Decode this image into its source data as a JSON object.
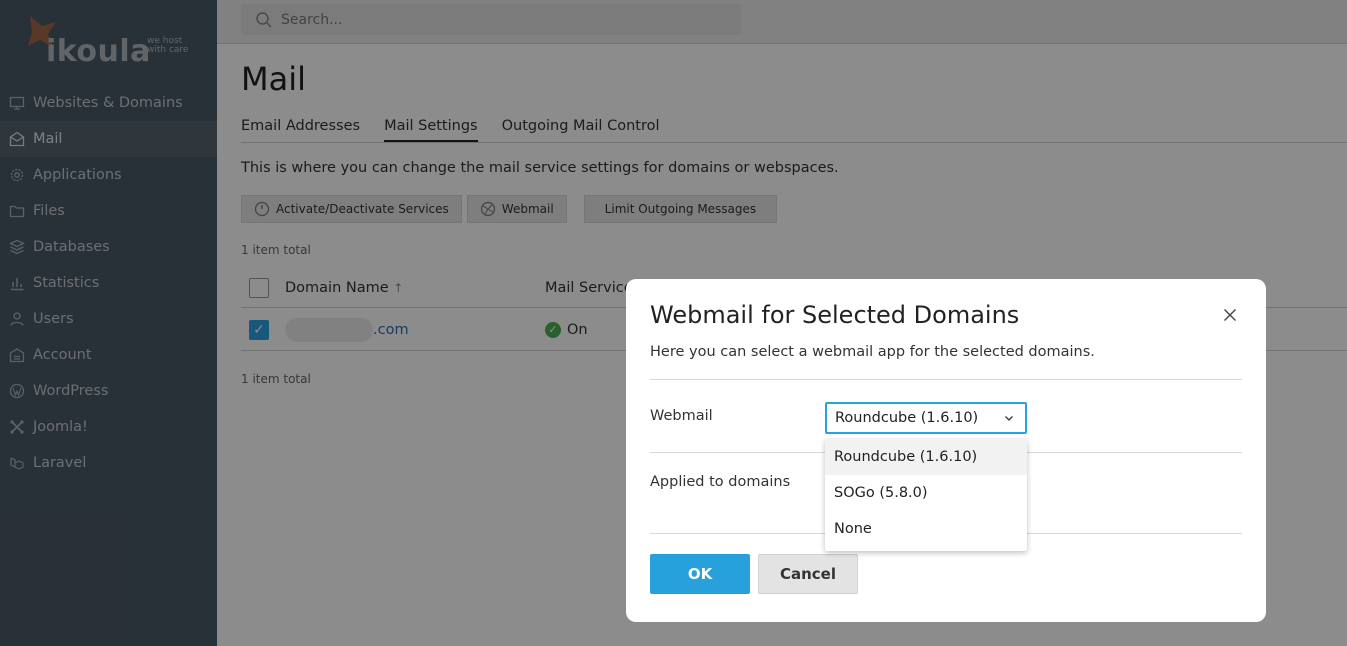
{
  "brand": {
    "logo_text": "ikoula",
    "tagline_1": "we host",
    "tagline_2": "with care"
  },
  "sidebar": {
    "items": [
      {
        "label": "Websites & Domains",
        "icon": "monitor-icon"
      },
      {
        "label": "Mail",
        "icon": "mail-icon",
        "active": true
      },
      {
        "label": "Applications",
        "icon": "gear-icon"
      },
      {
        "label": "Files",
        "icon": "folder-icon"
      },
      {
        "label": "Databases",
        "icon": "database-icon"
      },
      {
        "label": "Statistics",
        "icon": "bar-chart-icon"
      },
      {
        "label": "Users",
        "icon": "user-icon"
      },
      {
        "label": "Account",
        "icon": "account-icon"
      },
      {
        "label": "WordPress",
        "icon": "wordpress-icon"
      },
      {
        "label": "Joomla!",
        "icon": "joomla-icon"
      },
      {
        "label": "Laravel",
        "icon": "laravel-icon"
      }
    ],
    "collapse_glyph": "‹"
  },
  "search": {
    "placeholder": "Search..."
  },
  "page": {
    "title": "Mail",
    "tabs": [
      {
        "label": "Email Addresses"
      },
      {
        "label": "Mail Settings",
        "active": true
      },
      {
        "label": "Outgoing Mail Control"
      }
    ],
    "description": "This is where you can change the mail service settings for domains or webspaces.",
    "toolbar": {
      "activate": "Activate/Deactivate Services",
      "webmail": "Webmail",
      "limit": "Limit Outgoing Messages"
    },
    "count_top": "1 item total",
    "count_bottom": "1 item total",
    "table": {
      "col_domain": "Domain Name",
      "col_sort": "↑",
      "col_mail_service": "Mail Service",
      "row": {
        "domain_suffix": ".com",
        "status": "On"
      }
    }
  },
  "dialog": {
    "title": "Webmail for Selected Domains",
    "description": "Here you can select a webmail app for the selected domains.",
    "webmail_label": "Webmail",
    "selected": "Roundcube (1.6.10)",
    "options": [
      "Roundcube (1.6.10)",
      "SOGo (5.8.0)",
      "None"
    ],
    "applied_label": "Applied to domains",
    "ok": "OK",
    "cancel": "Cancel"
  },
  "colors": {
    "sidebar_bg": "#4a5866",
    "accent": "#28a0dc",
    "link": "#2b6dad",
    "status_on": "#4caf50"
  }
}
